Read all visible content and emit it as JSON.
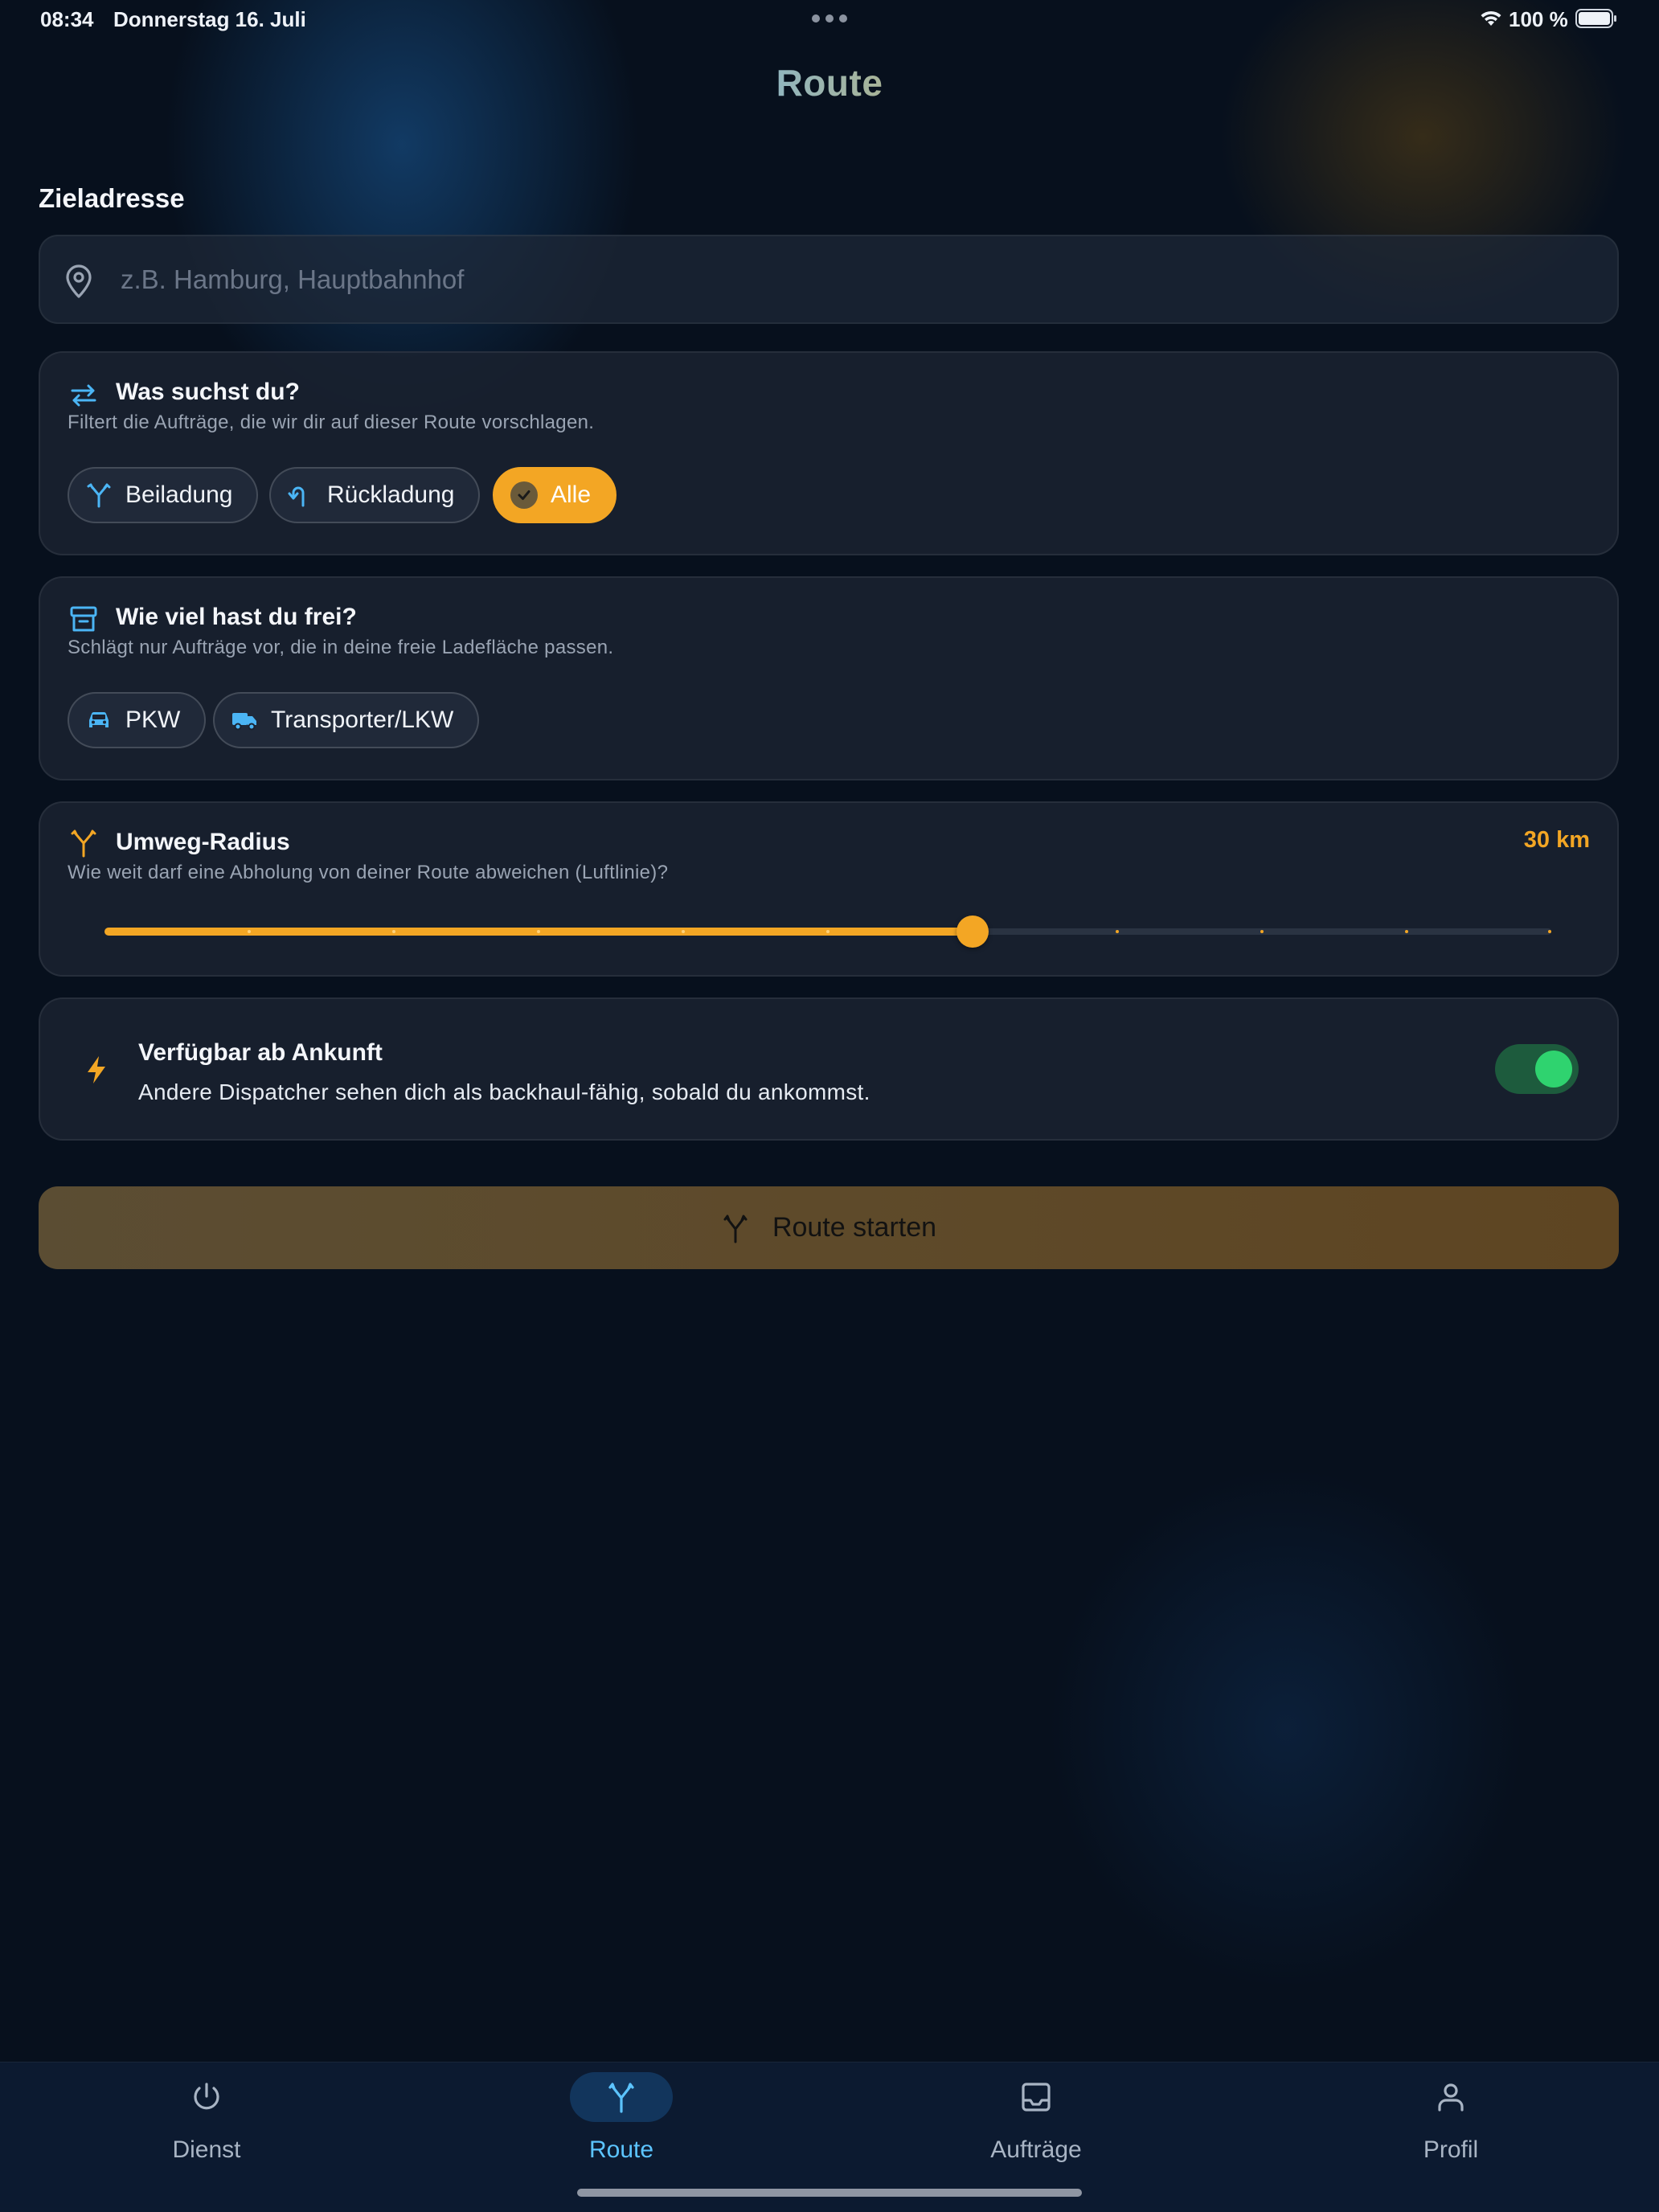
{
  "status_bar": {
    "time": "08:34",
    "date": "Donnerstag 16. Juli",
    "battery_percent": "100 %",
    "icons": [
      "wifi-icon",
      "battery-icon",
      "multitasking-dots-icon"
    ]
  },
  "header": {
    "title": "Route"
  },
  "destination": {
    "label": "Zieladresse",
    "value": "",
    "placeholder": "z.B. Hamburg, Hauptbahnhof",
    "icon": "map-pin-icon"
  },
  "search_type": {
    "icon": "swap-arrows-icon",
    "title": "Was suchst du?",
    "subtitle": "Filtert die Aufträge, die wir dir auf dieser Route vorschlagen.",
    "options": [
      {
        "label": "Beiladung",
        "icon": "merge-icon",
        "selected": false
      },
      {
        "label": "Rückladung",
        "icon": "return-arrow-icon",
        "selected": false
      },
      {
        "label": "Alle",
        "icon": "check-icon",
        "selected": true
      }
    ]
  },
  "capacity": {
    "icon": "archive-box-icon",
    "title": "Wie viel hast du frei?",
    "subtitle": "Schlägt nur Aufträge vor, die in deine freie Ladefläche passen.",
    "options": [
      {
        "label": "PKW",
        "icon": "car-icon",
        "selected": false
      },
      {
        "label": "Transporter/LKW",
        "icon": "truck-icon",
        "selected": false
      }
    ]
  },
  "detour": {
    "icon": "fork-route-icon",
    "title": "Umweg-Radius",
    "subtitle": "Wie weit darf eine Abholung von deiner Route abweichen (Luftlinie)?",
    "value_label": "30 km",
    "slider_step_index": 6,
    "slider_step_count": 10
  },
  "availability": {
    "icon": "lightning-icon",
    "title": "Verfügbar ab Ankunft",
    "subtitle": "Andere Dispatcher sehen dich als backhaul-fähig, sobald du ankommst.",
    "enabled": true
  },
  "start_button": {
    "label": "Route starten",
    "icon": "fork-route-icon"
  },
  "tabbar": {
    "tabs": [
      {
        "label": "Dienst",
        "icon": "power-icon",
        "active": false
      },
      {
        "label": "Route",
        "icon": "fork-route-icon",
        "active": true
      },
      {
        "label": "Aufträge",
        "icon": "inbox-icon",
        "active": false
      },
      {
        "label": "Profil",
        "icon": "user-icon",
        "active": false
      }
    ]
  },
  "colors": {
    "accent_orange": "#f3a624",
    "accent_blue": "#5cc4ff",
    "toggle_on": "#2fd36f",
    "background": "#07101d"
  }
}
